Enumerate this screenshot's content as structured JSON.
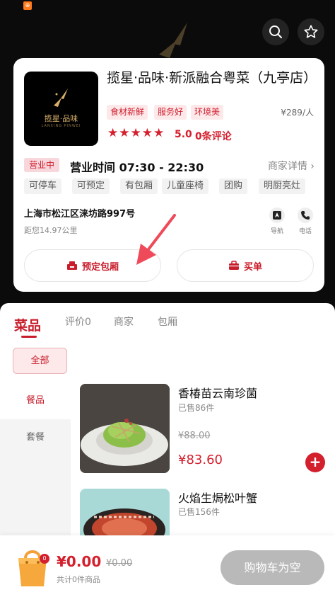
{
  "status_icon": "app-notification-icon",
  "header": {
    "search_icon": "search-icon",
    "favorite_icon": "star-outline-icon"
  },
  "shop": {
    "logo_text": "揽星·品味",
    "logo_subtext": "LANXING PINWEI",
    "name": "揽星·品味·新派融合粤菜（九亭店）",
    "tags": [
      "食材新鲜",
      "服务好",
      "环境美"
    ],
    "price_per_person": "¥289/人",
    "star_count": 5,
    "rating": "5.0",
    "comments": "0条评论",
    "open_status": "营业中",
    "hours": "营业时间 07:30 - 22:30",
    "details_link": "商家详情",
    "facilities": [
      "可停车",
      "可预定",
      "有包厢",
      "儿童座椅",
      "团购",
      "明厨亮灶"
    ],
    "address": "上海市松江区涞坊路997号",
    "distance": "距您14.97公里",
    "nav_label": "导航",
    "phone_label": "电话",
    "reserve_button": "预定包厢",
    "buy_button": "买单"
  },
  "tabs": [
    {
      "label": "菜品",
      "active": true
    },
    {
      "label": "评价0",
      "active": false
    },
    {
      "label": "商家",
      "active": false
    },
    {
      "label": "包厢",
      "active": false
    }
  ],
  "category_all": "全部",
  "side_categories": [
    {
      "label": "餐品",
      "active": true
    },
    {
      "label": "套餐",
      "active": false
    }
  ],
  "dishes": [
    {
      "name": "香椿苗云南珍菌",
      "sold": "已售86件",
      "original_price": "¥88.00",
      "price": "¥83.60"
    },
    {
      "name": "火焰生焗松叶蟹",
      "sold": "已售156件",
      "original_price": "",
      "price": ""
    }
  ],
  "cart": {
    "badge": "0",
    "total": "¥0.00",
    "original_total": "¥0.00",
    "count_text": "共计0件商品",
    "checkout_label": "购物车为空"
  },
  "colors": {
    "accent": "#d41f2d",
    "tag_bg": "#fde9ea",
    "checkout_disabled": "#b9b9b9"
  }
}
